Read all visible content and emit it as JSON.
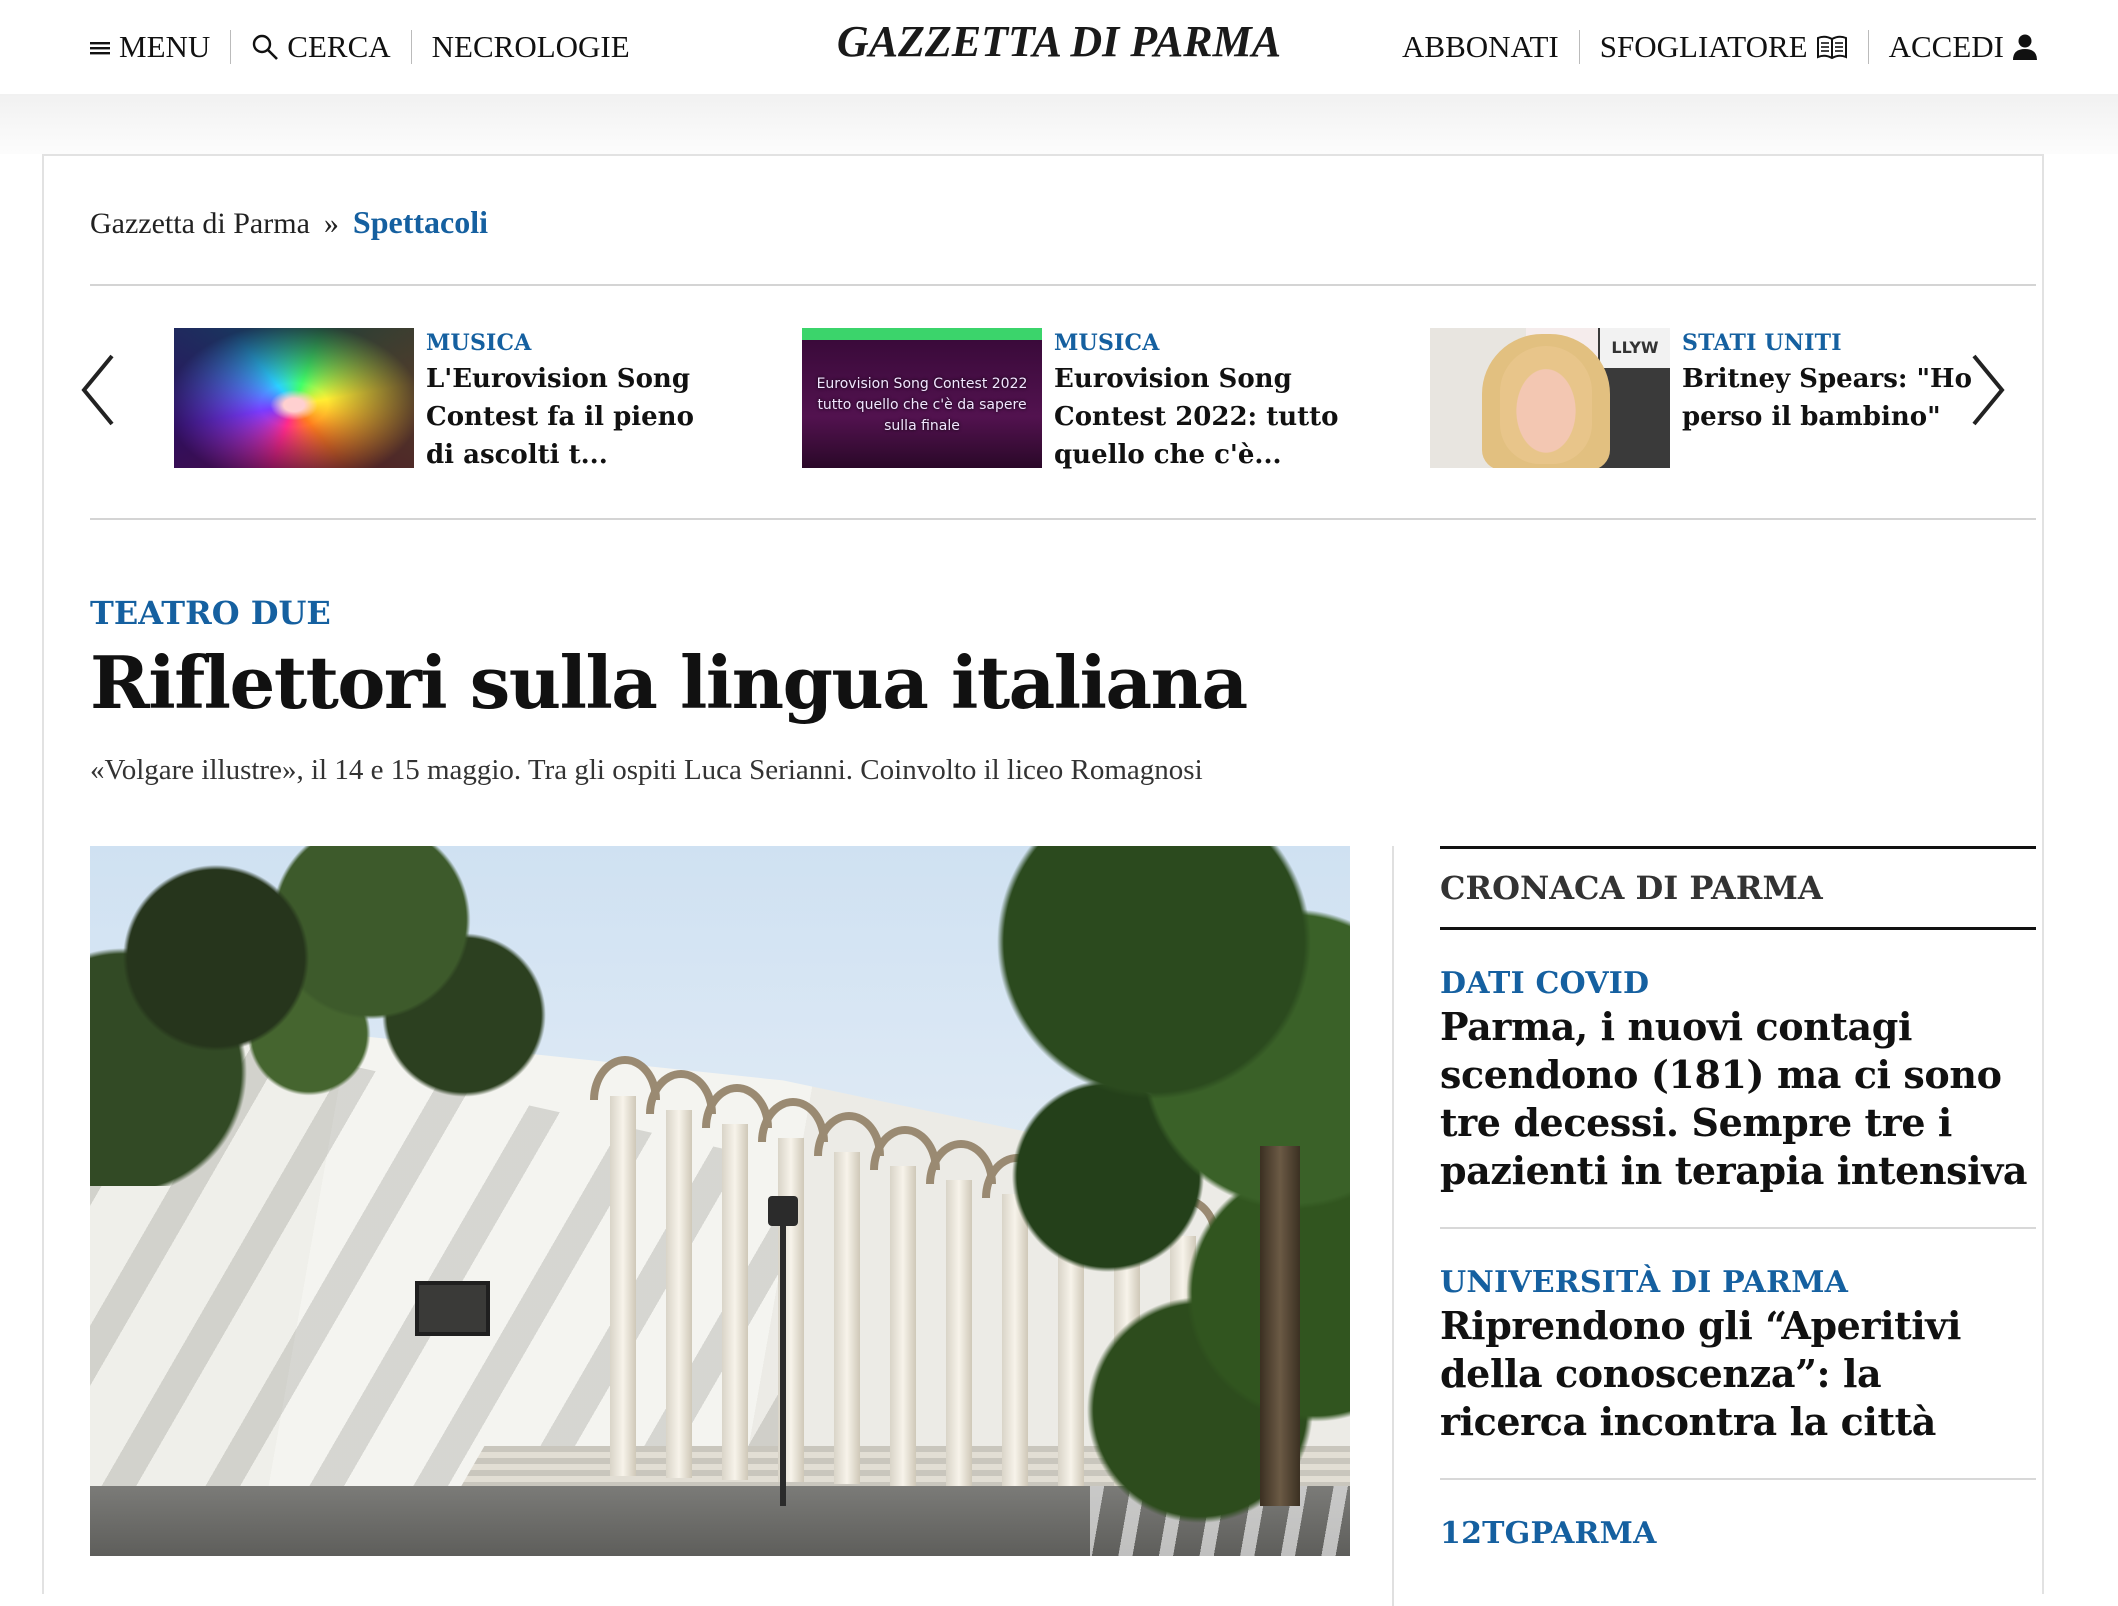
{
  "header": {
    "brand": "GAZZETTA DI PARMA",
    "left_nav": [
      {
        "label": "MENU",
        "icon": "hamburger-icon"
      },
      {
        "label": "CERCA",
        "icon": "search-icon"
      },
      {
        "label": "NECROLOGIE"
      }
    ],
    "right_nav": [
      {
        "label": "ABBONATI"
      },
      {
        "label": "SFOGLIATORE",
        "icon": "open-book-icon"
      },
      {
        "label": "ACCEDI",
        "icon": "user-icon"
      }
    ]
  },
  "breadcrumb": {
    "home": "Gazzetta di Parma",
    "separator": "»",
    "current": "Spettacoli"
  },
  "carousel": {
    "items": [
      {
        "kicker": "MUSICA",
        "title": "L'Eurovision Song Contest fa il pieno di ascolti t..."
      },
      {
        "kicker": "MUSICA",
        "title": "Eurovision Song Contest 2022: tutto quello che c'è...",
        "thumb_text": [
          "Eurovision Song Contest 2022",
          "tutto quello che c'è da sapere",
          "sulla finale"
        ]
      },
      {
        "kicker": "STATI UNITI",
        "title": "Britney Spears: \"Ho perso il bambino\"",
        "thumb_text": "LLYW"
      }
    ]
  },
  "article": {
    "kicker": "TEATRO DUE",
    "title": "Riflettori sulla lingua italiana",
    "subtitle": "«Volgare illustre», il 14 e 15 maggio. Tra gli ospiti Luca Serianni. Coinvolto il liceo Romagnosi"
  },
  "sidebar": {
    "heading": "CRONACA DI PARMA",
    "items": [
      {
        "kicker": "DATI COVID",
        "title": "Parma, i nuovi contagi scendono (181) ma ci sono tre decessi. Sempre tre i pazienti in terapia intensiva"
      },
      {
        "kicker": "UNIVERSITÀ DI PARMA",
        "title": "Riprendono gli “Aperitivi della conoscenza”: la ricerca incontra la città"
      },
      {
        "kicker": "12TGPARMA",
        "title": ""
      }
    ]
  },
  "colors": {
    "accent": "#1560a0",
    "text": "#111111",
    "rule": "#d4d4d4"
  }
}
